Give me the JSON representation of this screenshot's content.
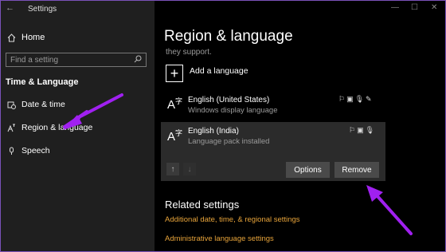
{
  "window": {
    "title": "Settings",
    "back_glyph": "←",
    "minimize_glyph": "—",
    "maximize_glyph": "☐",
    "close_glyph": "✕"
  },
  "sidebar": {
    "home_label": "Home",
    "search_placeholder": "Find a setting",
    "section_title": "Time & Language",
    "items": [
      {
        "label": "Date & time",
        "icon": "calendar-clock-icon"
      },
      {
        "label": "Region & language",
        "icon": "region-language-icon"
      },
      {
        "label": "Speech",
        "icon": "microphone-icon"
      }
    ]
  },
  "main": {
    "title": "Region & language",
    "subtitle": "they support.",
    "add_language_label": "Add a language",
    "languages": [
      {
        "name": "English (United States)",
        "status": "Windows display language",
        "selected": false
      },
      {
        "name": "English (India)",
        "status": "Language pack installed",
        "selected": true
      }
    ],
    "options_label": "Options",
    "remove_label": "Remove",
    "related_title": "Related settings",
    "related_links": [
      "Additional date, time, & regional settings",
      "Administrative language settings"
    ]
  },
  "colors": {
    "accent_link": "#e8a43a",
    "annotation_arrow": "#a020f0",
    "sidebar_bg": "#1f1f1f",
    "main_bg": "#000000",
    "selected_row_bg": "#2b2b2b"
  }
}
